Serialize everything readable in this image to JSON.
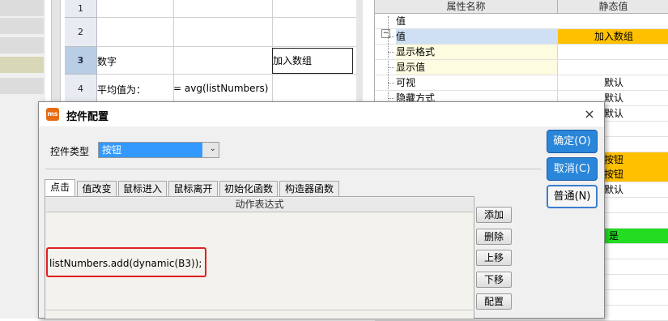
{
  "sheet": {
    "rows": [
      {
        "num": "1",
        "cells": []
      },
      {
        "num": "2",
        "cells": []
      },
      {
        "num": "3",
        "cells": [
          "数字",
          "",
          "加入数组"
        ]
      },
      {
        "num": "4",
        "cells": [
          "平均值为：",
          "= avg(listNumbers)",
          ""
        ]
      }
    ]
  },
  "props": {
    "col_name": "属性名称",
    "col_value": "静态值",
    "group": "值",
    "items": [
      {
        "name": "值",
        "value": "加入数组"
      },
      {
        "name": "显示格式",
        "value": ""
      },
      {
        "name": "显示值",
        "value": ""
      },
      {
        "name": "可视",
        "value": "默认"
      },
      {
        "name": "隐藏方式",
        "value": "默认"
      },
      {
        "name": "",
        "value": "默认"
      }
    ],
    "extra_values": [
      "按钮",
      "按钮",
      "默认",
      "是"
    ]
  },
  "dialog": {
    "title": "控件配置",
    "logo_text": "ms",
    "close_glyph": "×",
    "control_type_label": "控件类型",
    "control_type_value": "按钮",
    "tabs": [
      "点击",
      "值改变",
      "鼠标进入",
      "鼠标离开",
      "初始化函数",
      "构造器函数"
    ],
    "active_tab": 0,
    "expr_header": "动作表达式",
    "expression": "listNumbers.add(dynamic(B3));",
    "side_buttons": [
      "添加",
      "删除",
      "上移",
      "下移",
      "配置"
    ],
    "ok_label": "确定(O)",
    "cancel_label": "取消(C)",
    "normal_label": "普通(N)"
  },
  "colors": {
    "accent": "#2a86d8",
    "highlight_value": "#ffc000",
    "true_value": "#22dd22",
    "annotation": "#e02020"
  }
}
